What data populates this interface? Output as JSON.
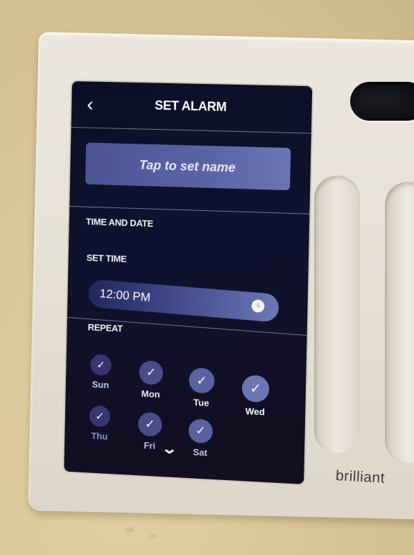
{
  "screen": {
    "header": {
      "back_icon": "chevron-left-icon",
      "back_glyph": "‹",
      "title": "SET ALARM"
    },
    "name_button": {
      "label": "Tap to set name"
    },
    "sections": {
      "time_and_date": "TIME AND DATE",
      "set_time": "SET TIME",
      "repeat": "REPEAT"
    },
    "time_field": {
      "value": "12:00 PM",
      "icon": "clock-icon"
    },
    "repeat_days": [
      {
        "label": "Sun",
        "checked": true
      },
      {
        "label": "Mon",
        "checked": true
      },
      {
        "label": "Tue",
        "checked": true
      },
      {
        "label": "Wed",
        "checked": true
      },
      {
        "label": "Thu",
        "checked": true
      },
      {
        "label": "Fri",
        "checked": true
      },
      {
        "label": "Sat",
        "checked": true
      }
    ],
    "check_glyph": "✓",
    "scroll_indicator": {
      "icon": "chevron-down-icon",
      "glyph": "⌄"
    }
  },
  "device": {
    "brand": "brilliant"
  },
  "colors": {
    "screen_bg": "#0e1230",
    "accent": "#5a64a5",
    "day_circle_dim": "#3a3470",
    "day_circle_bright": "#6d76b4",
    "plate": "#e6e0d5",
    "wall": "#d9c597"
  }
}
